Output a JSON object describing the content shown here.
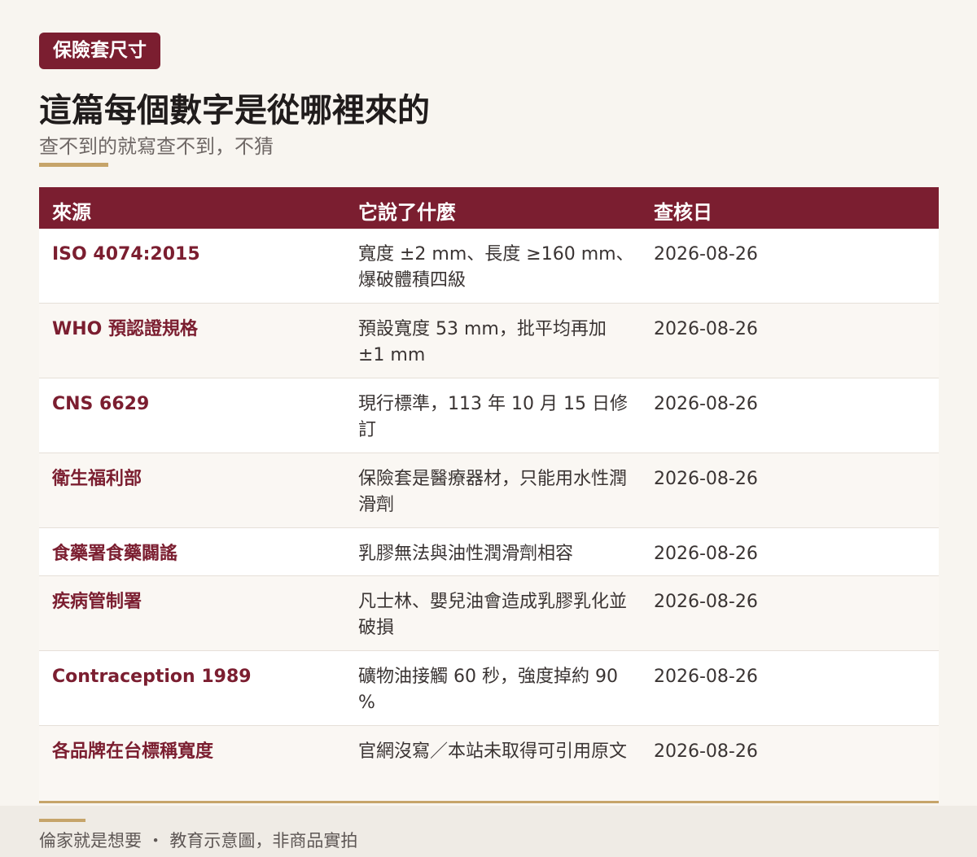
{
  "tag": "保險套尺寸",
  "title": "這篇每個數字是從哪裡來的",
  "subtitle": "查不到的就寫查不到，不猜",
  "table": {
    "headers": [
      "來源",
      "它說了什麼",
      "查核日"
    ],
    "rows": [
      {
        "source": "ISO 4074:2015",
        "claim": "寬度 ±2 mm、長度 ≥160 mm、爆破體積四級",
        "date": "2026-08-26"
      },
      {
        "source": "WHO 預認證規格",
        "claim": "預設寬度 53 mm，批平均再加 ±1 mm",
        "date": "2026-08-26"
      },
      {
        "source": "CNS 6629",
        "claim": "現行標準，113 年 10 月 15 日修訂",
        "date": "2026-08-26"
      },
      {
        "source": "衛生福利部",
        "claim": "保險套是醫療器材，只能用水性潤滑劑",
        "date": "2026-08-26"
      },
      {
        "source": "食藥署食藥闢謠",
        "claim": "乳膠無法與油性潤滑劑相容",
        "date": "2026-08-26"
      },
      {
        "source": "疾病管制署",
        "claim": "凡士林、嬰兒油會造成乳膠乳化並破損",
        "date": "2026-08-26"
      },
      {
        "source": "Contraception 1989",
        "claim": "礦物油接觸 60 秒，強度掉約 90 %",
        "date": "2026-08-26"
      },
      {
        "source": "各品牌在台標稱寬度",
        "claim": "官網沒寫／本站未取得可引用原文",
        "date": "2026-08-26"
      }
    ]
  },
  "footer": "倫家就是想要 ・ 教育示意圖，非商品實拍"
}
